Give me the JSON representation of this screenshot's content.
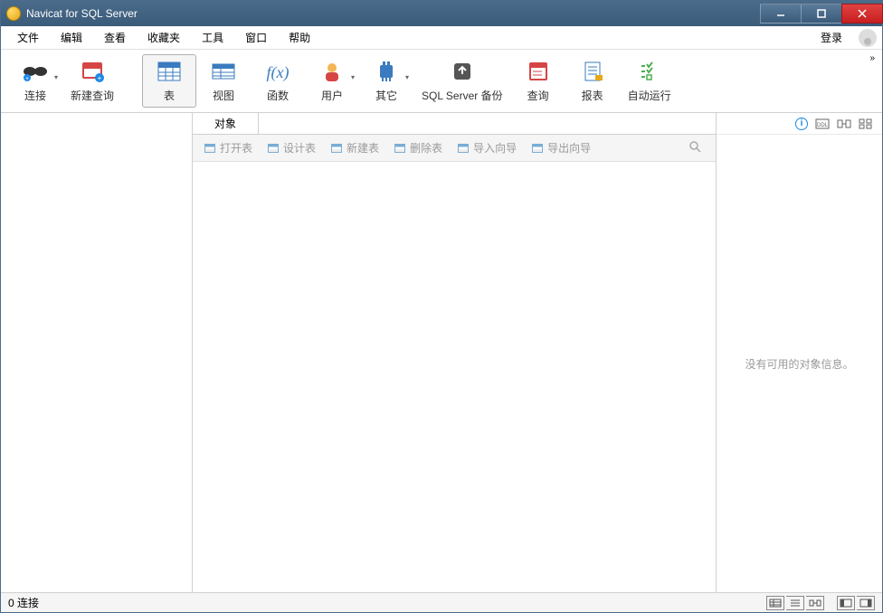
{
  "window": {
    "title": "Navicat for SQL Server"
  },
  "menu": {
    "items": [
      "文件",
      "编辑",
      "查看",
      "收藏夹",
      "工具",
      "窗口",
      "帮助"
    ],
    "login": "登录"
  },
  "toolbar": {
    "connect": "连接",
    "new_query": "新建查询",
    "table": "表",
    "view": "视图",
    "function": "函数",
    "user": "用户",
    "other": "其它",
    "backup": "SQL Server 备份",
    "query": "查询",
    "report": "报表",
    "autorun": "自动运行"
  },
  "subtab": {
    "object": "对象"
  },
  "subtoolbar": {
    "open_table": "打开表",
    "design_table": "设计表",
    "new_table": "新建表",
    "delete_table": "删除表",
    "import_wizard": "导入向导",
    "export_wizard": "导出向导"
  },
  "right_panel": {
    "empty_msg": "没有可用的对象信息。"
  },
  "statusbar": {
    "connections": "0 连接"
  }
}
